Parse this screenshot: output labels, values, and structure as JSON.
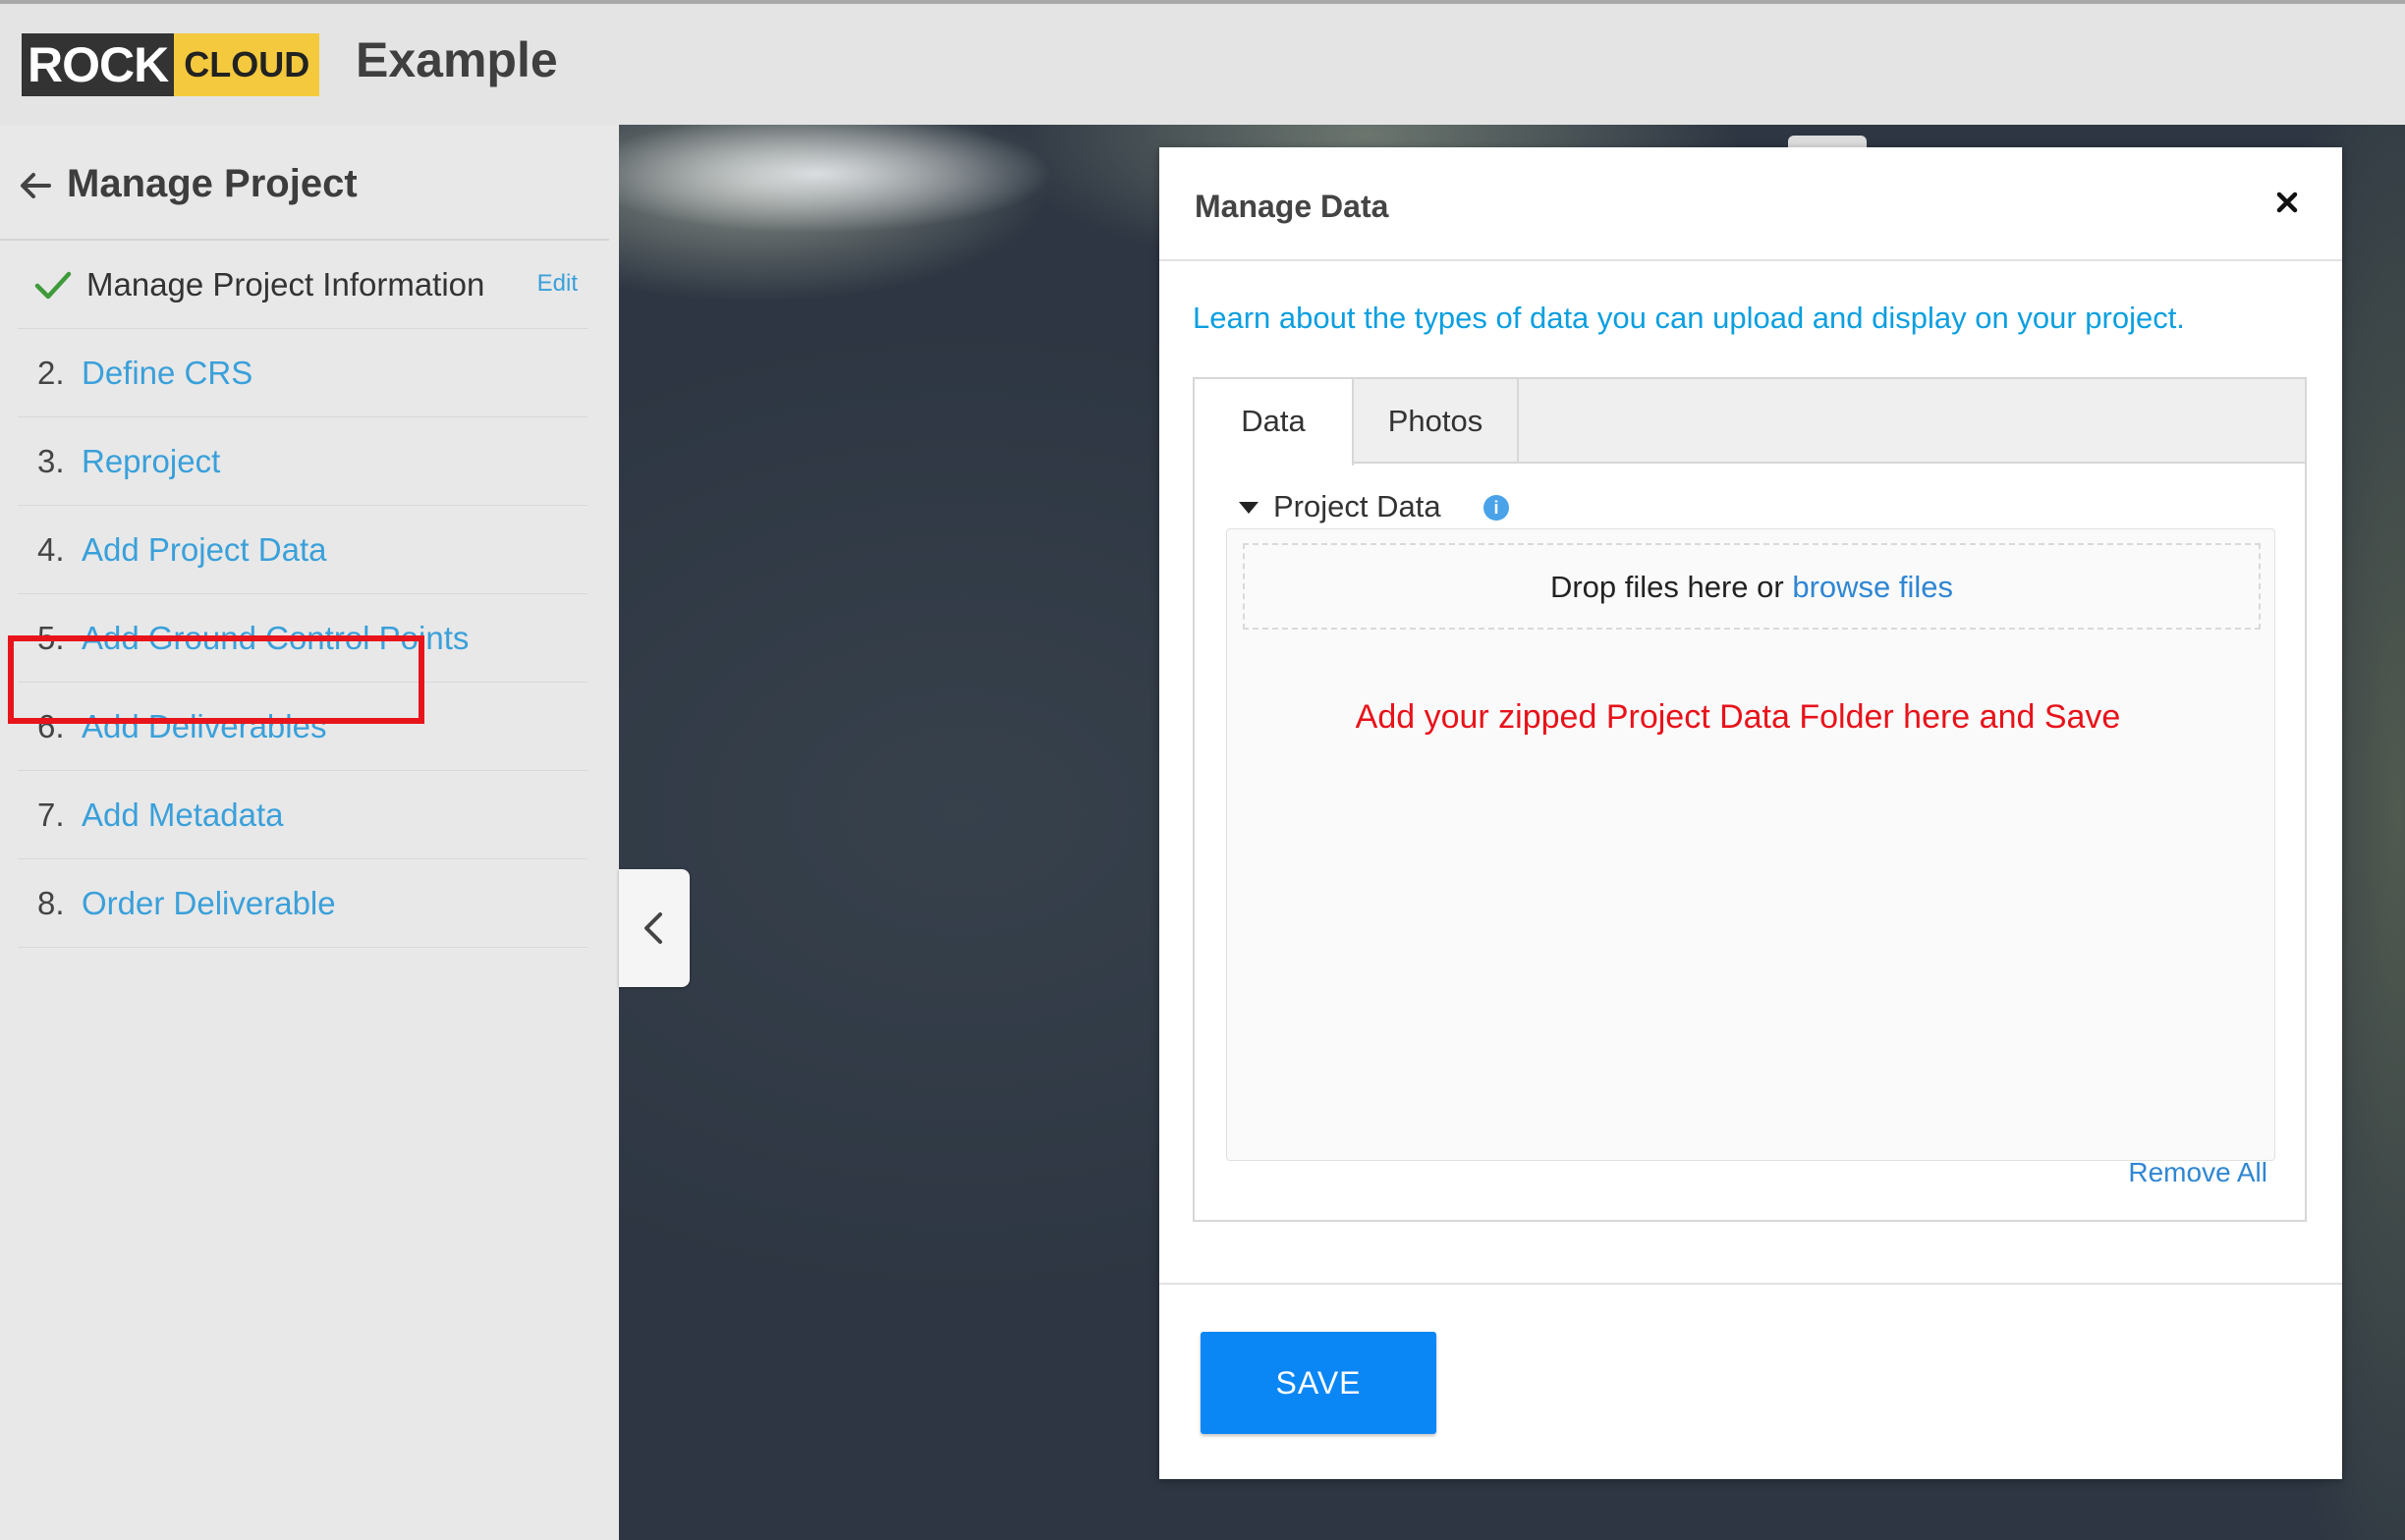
{
  "header": {
    "logo_rock": "ROCK",
    "logo_cloud": "CLOUD",
    "title": "Example"
  },
  "sidebar": {
    "title": "Manage Project",
    "first_step": {
      "label": "Manage Project Information",
      "edit_label": "Edit"
    },
    "steps": [
      {
        "num": "2.",
        "label": "Define CRS"
      },
      {
        "num": "3.",
        "label": "Reproject"
      },
      {
        "num": "4.",
        "label": "Add Project Data"
      },
      {
        "num": "5.",
        "label": "Add Ground Control Points"
      },
      {
        "num": "6.",
        "label": "Add Deliverables"
      },
      {
        "num": "7.",
        "label": "Add Metadata"
      },
      {
        "num": "8.",
        "label": "Order Deliverable"
      }
    ]
  },
  "modal": {
    "title": "Manage Data",
    "learn_link": "Learn about the types of data you can upload and display on your project.",
    "tabs": [
      {
        "label": "Data"
      },
      {
        "label": "Photos"
      }
    ],
    "section_label": "Project Data",
    "drop_text": "Drop files here or",
    "browse_label": "browse files",
    "instruction": "Add your zipped Project Data Folder here and Save",
    "remove_all": "Remove All",
    "save_label": "SAVE"
  },
  "colors": {
    "accent_link": "#3aa0da",
    "primary_button": "#0b86f5",
    "highlight_red": "#e8141b",
    "logo_yellow": "#f4c93d"
  },
  "icons": {
    "back": "arrow-left-icon",
    "done": "checkmark-icon",
    "close": "close-icon",
    "info": "info-icon",
    "caret": "caret-down-icon",
    "collapse": "chevron-left-icon"
  }
}
